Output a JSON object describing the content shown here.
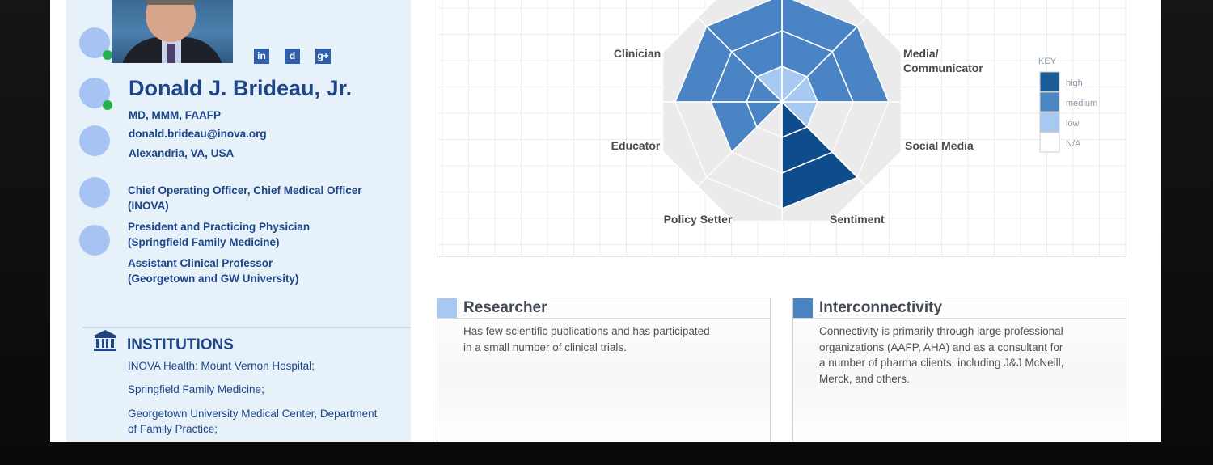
{
  "profile": {
    "name": "Donald J. Brideau, Jr.",
    "credentials": "MD, MMM, FAAFP",
    "email": "donald.brideau@inova.org",
    "location": "Alexandria, VA, USA",
    "social_icons": [
      "linkedin-icon",
      "doximity-icon",
      "google-plus-icon"
    ],
    "roles": [
      {
        "title": "Chief Operating Officer, Chief Medical Officer",
        "org": "(INOVA)"
      },
      {
        "title": "President and Practicing Physician",
        "org": "(Springfield Family Medicine)"
      },
      {
        "title": "Assistant Clinical Professor",
        "org": "(Georgetown and GW University)"
      }
    ]
  },
  "institutions": {
    "heading": "INSTITUTIONS",
    "items": [
      "INOVA Health: Mount Vernon Hospital;",
      "Springfield Family Medicine;",
      "Georgetown University Medical Center, Department",
      "of Family Practice;"
    ]
  },
  "chart_data": {
    "type": "radar",
    "axes": [
      "Media/ Communicator",
      "Social Media",
      "Sentiment",
      "Policy Setter",
      "Educator",
      "Clinician"
    ],
    "axis_labels": {
      "media_line1": "Media/",
      "media_line2": "Communicator",
      "social": "Social Media",
      "sentiment": "Sentiment",
      "policy": "Policy Setter",
      "educator": "Educator",
      "clinician": "Clinician"
    },
    "ring_levels": [
      "low",
      "medium",
      "high"
    ],
    "legend": {
      "title": "KEY",
      "items": [
        {
          "label": "high",
          "color": "#1b5b96"
        },
        {
          "label": "medium",
          "color": "#4b86c5"
        },
        {
          "label": "low",
          "color": "#a7c8f0"
        },
        {
          "label": "N/A",
          "color": "#ffffff"
        }
      ]
    },
    "colors": {
      "high": "#0f4c8c",
      "medium": "#4a84c4",
      "low": "#a7c8f0",
      "na": "#ebebeb"
    }
  },
  "cards": [
    {
      "title": "Researcher",
      "swatch": "#a7c8f0",
      "lines": [
        "Has few scientific publications and has participated",
        "in a small number of clinical trials."
      ]
    },
    {
      "title": "Interconnectivity",
      "swatch": "#4a84c4",
      "lines": [
        "Connectivity is primarily through large professional",
        "organizations (AAFP, AHA) and as a consultant for",
        "a number of pharma clients, including J&J McNeill,",
        "Merck, and others."
      ]
    }
  ]
}
